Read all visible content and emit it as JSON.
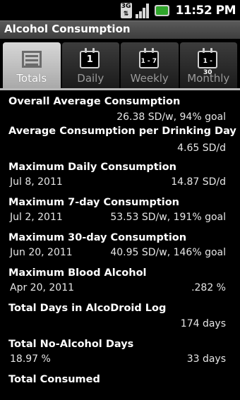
{
  "status": {
    "network": "3G",
    "time": "11:52 PM"
  },
  "app_title": "Alcohol Consumption",
  "tabs": [
    {
      "label": "Totals",
      "icon": "abacus-icon",
      "active": true
    },
    {
      "label": "Daily",
      "icon": "calendar-1-icon",
      "cal_text": "1"
    },
    {
      "label": "Weekly",
      "icon": "calendar-1-7-icon",
      "cal_text": "1 - 7"
    },
    {
      "label": "Monthly",
      "icon": "calendar-1-30-icon",
      "cal_text": "1 - 30"
    }
  ],
  "stats": {
    "overall_avg": {
      "title": "Overall Average Consumption",
      "value": "26.38 SD/w, 94% goal"
    },
    "avg_per_day": {
      "title": "Average Consumption per Drinking Day",
      "value": "4.65 SD/d"
    },
    "max_daily": {
      "title": "Maximum Daily Consumption",
      "date": "Jul 8, 2011",
      "value": "14.87 SD/d"
    },
    "max_7day": {
      "title": "Maximum 7-day Consumption",
      "date": "Jul 2, 2011",
      "value": "53.53 SD/w, 191% goal"
    },
    "max_30day": {
      "title": "Maximum 30-day Consumption",
      "date": "Jun 20, 2011",
      "value": "40.95 SD/w, 146% goal"
    },
    "max_bac": {
      "title": "Maximum Blood Alcohol",
      "date": "Apr 20, 2011",
      "value": ".282 %"
    },
    "total_days": {
      "title": "Total Days in AlcoDroid Log",
      "value": "174 days"
    },
    "no_alcohol": {
      "title": "Total No-Alcohol Days",
      "percent": "18.97 %",
      "value": "33 days"
    },
    "total_consumed": {
      "title": "Total Consumed"
    }
  },
  "colors": {
    "background": "#000000",
    "active_tab": "#c4c4c4",
    "battery": "#2fa52a"
  }
}
